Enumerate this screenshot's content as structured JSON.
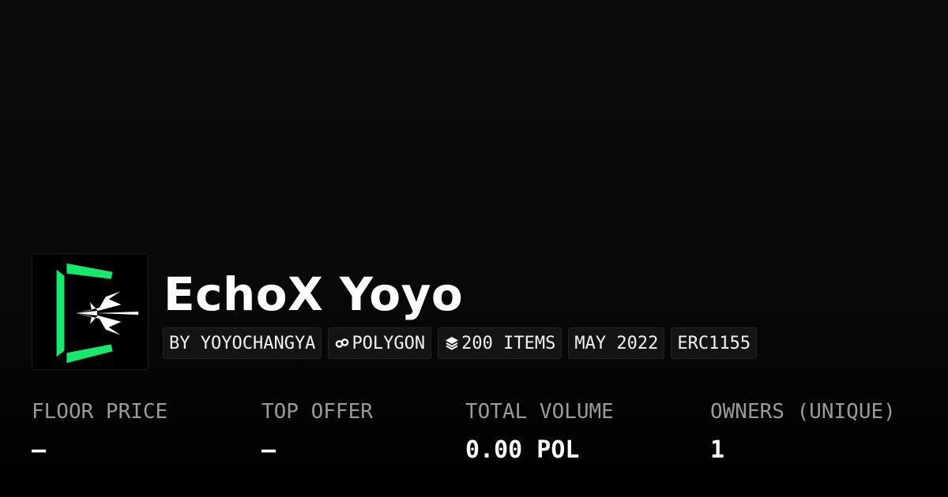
{
  "collection": {
    "name": "EchoX Yoyo",
    "logo_icon": "echox-bracket-logo-icon",
    "accent_color": "#17e76d"
  },
  "chips": {
    "creator": "BY YOYOCHANGYA",
    "chain": "POLYGON",
    "chain_icon": "polygon-icon",
    "items": "200 ITEMS",
    "items_icon": "layers-icon",
    "date": "MAY 2022",
    "standard": "ERC1155"
  },
  "stats": {
    "floor_price": {
      "label": "FLOOR PRICE",
      "value": "–"
    },
    "top_offer": {
      "label": "TOP OFFER",
      "value": "–"
    },
    "total_volume": {
      "label": "TOTAL VOLUME",
      "value": "0.00 POL"
    },
    "owners": {
      "label": "OWNERS (UNIQUE)",
      "value": "1"
    }
  }
}
